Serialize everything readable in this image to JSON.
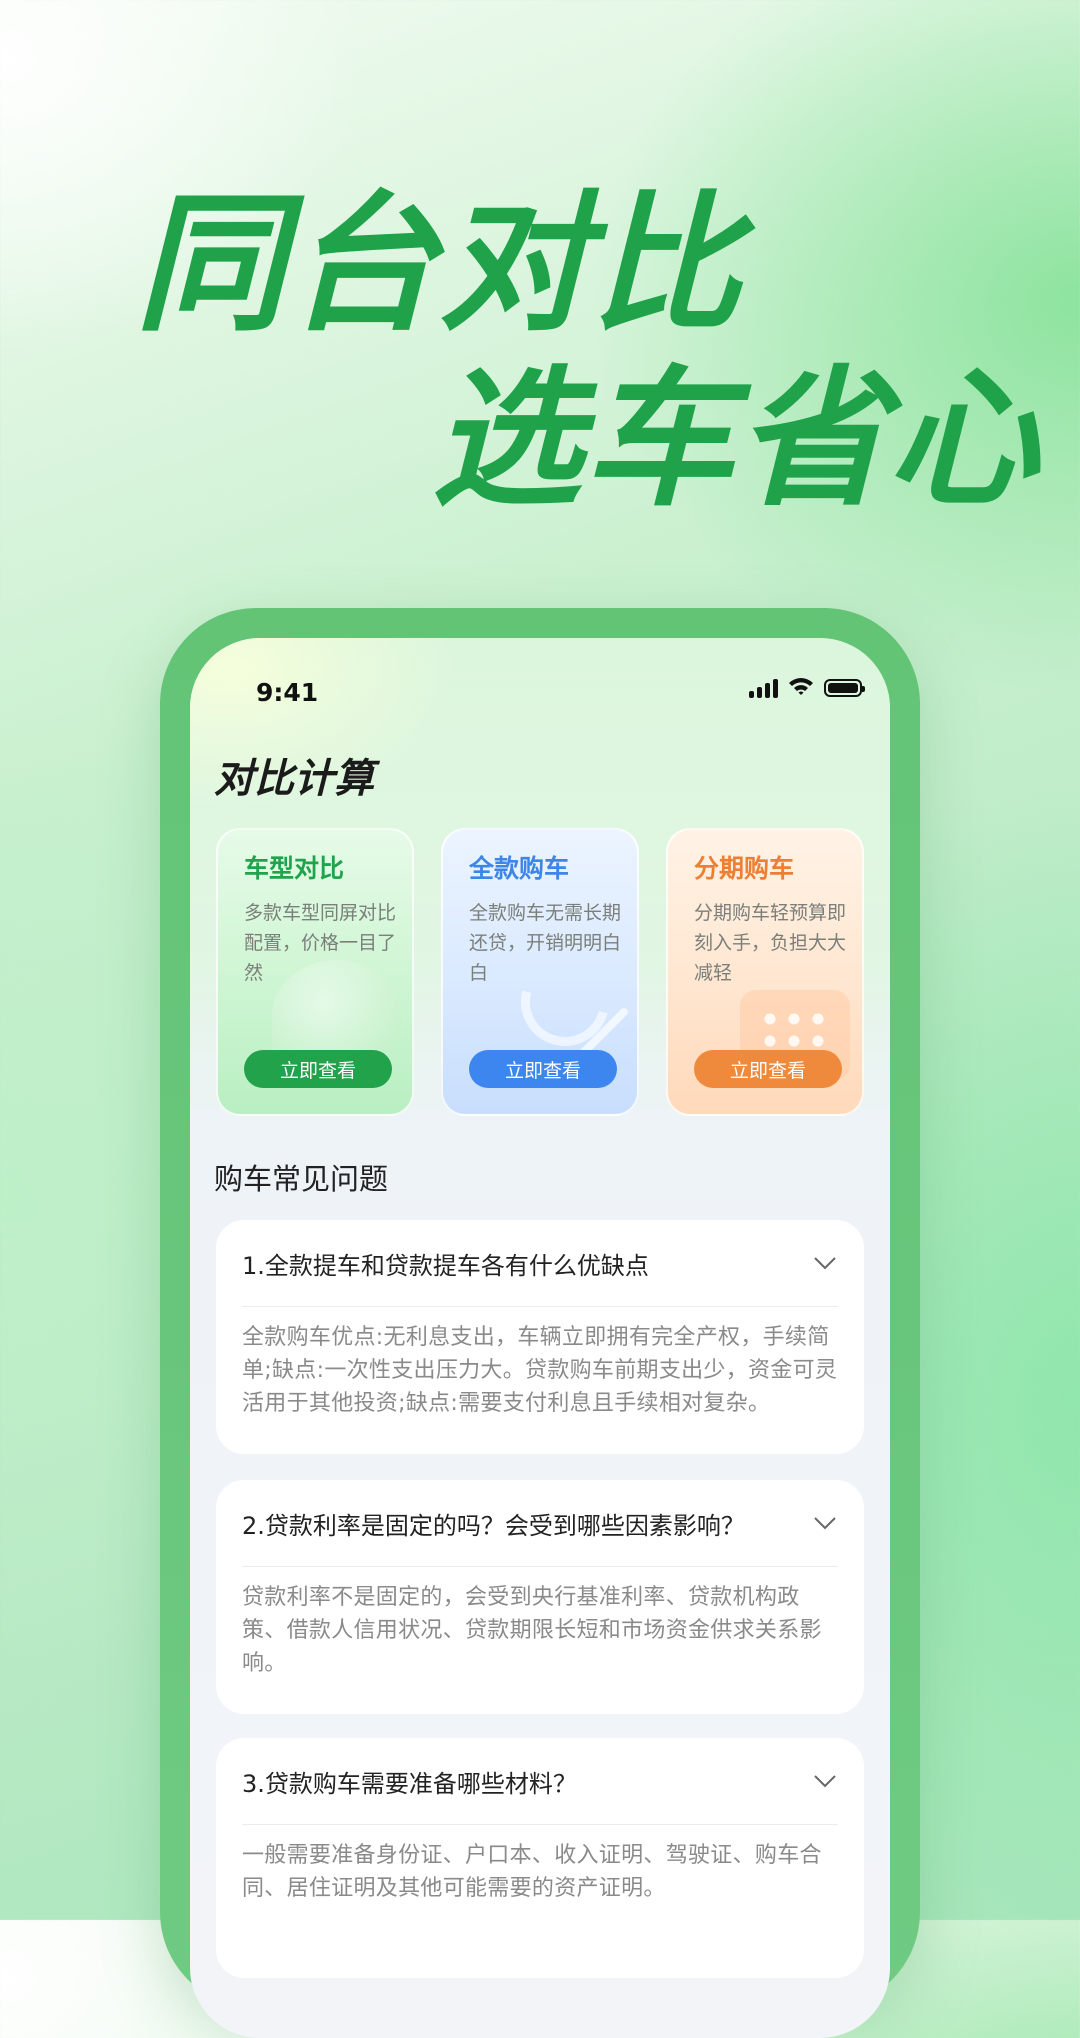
{
  "hero": {
    "line1": "同台对比",
    "line2": "选车省心"
  },
  "status_bar": {
    "time": "9:41",
    "icons": [
      "signal-icon",
      "wifi-icon",
      "battery-icon"
    ]
  },
  "page": {
    "title": "对比计算"
  },
  "cards": [
    {
      "title": "车型对比",
      "desc": "多款车型同屏对比配置，价格一目了然",
      "button": "立即查看",
      "accent": "#21a24c"
    },
    {
      "title": "全款购车",
      "desc": "全款购车无需长期还贷，开销明明白白",
      "button": "立即查看",
      "accent": "#3d86e6"
    },
    {
      "title": "分期购车",
      "desc": "分期购车轻预算即刻入手，负担大大减轻",
      "button": "立即查看",
      "accent": "#ec7f33"
    }
  ],
  "faq": {
    "heading": "购车常见问题",
    "items": [
      {
        "question": "1.全款提车和贷款提车各有什么优缺点",
        "answer": "全款购车优点:无利息支出，车辆立即拥有完全产权，手续简单;缺点:一次性支出压力大。贷款购车前期支出少，资金可灵活用于其他投资;缺点:需要支付利息且手续相对复杂。"
      },
      {
        "question": "2.贷款利率是固定的吗？会受到哪些因素影响？",
        "answer": "贷款利率不是固定的，会受到央行基准利率、贷款机构政策、借款人信用状况、贷款期限长短和市场资金供求关系影响。"
      },
      {
        "question": "3.贷款购车需要准备哪些材料？",
        "answer": "一般需要准备身份证、户口本、收入证明、驾驶证、购车合同、居住证明及其他可能需要的资产证明。"
      }
    ]
  },
  "colors": {
    "brand_green": "#1fa24a",
    "phone_frame": "#63c476"
  }
}
